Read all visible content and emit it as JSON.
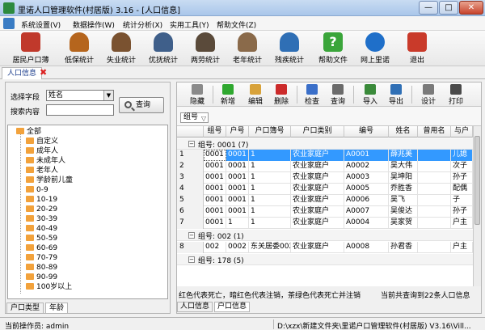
{
  "window": {
    "title": "里诺人口管理软件(村居版) 3.16 - [人口信息]",
    "min_label": "—",
    "max_label": "□",
    "close_label": "✕"
  },
  "menu": [
    "系统设置(V)",
    "数据操作(W)",
    "统计分析(X)",
    "实用工具(Y)",
    "帮助文件(Z)"
  ],
  "toolbar": [
    {
      "label": "居民户口薄",
      "icon": "resident-book-icon",
      "color": "#c0392b"
    },
    {
      "label": "低保统计",
      "icon": "person-icon",
      "color": "#b5651d"
    },
    {
      "label": "失业统计",
      "icon": "person-icon",
      "color": "#7a5230"
    },
    {
      "label": "优抚统计",
      "icon": "person-icon",
      "color": "#3f5f8a"
    },
    {
      "label": "两劳统计",
      "icon": "person-icon",
      "color": "#5a4a3a"
    },
    {
      "label": "老年统计",
      "icon": "person-icon",
      "color": "#8a6a4a"
    },
    {
      "label": "残疾统计",
      "icon": "person-icon",
      "color": "#2f6fb5"
    },
    {
      "label": "帮助文件",
      "icon": "help-icon",
      "color": "#3aa53a"
    },
    {
      "label": "网上里诺",
      "icon": "globe-icon",
      "color": "#1f6fc9"
    },
    {
      "label": "退出",
      "icon": "exit-icon",
      "color": "#c93a2a"
    }
  ],
  "doc_tab": {
    "label": "人口信息",
    "close": "✖"
  },
  "left": {
    "field_label": "选择字段",
    "field_value": "姓名",
    "search_label": "搜索内容",
    "query_label": "查询",
    "tree": [
      "全部",
      "自定义",
      "成年人",
      "未成年人",
      "老年人",
      "学龄前儿童",
      "0-9",
      "10-19",
      "20-29",
      "30-39",
      "40-49",
      "50-59",
      "60-69",
      "70-79",
      "80-89",
      "90-99",
      "100岁以上"
    ],
    "tabs": [
      "户口类型",
      "年龄"
    ]
  },
  "right_toolbar": [
    {
      "label": "隐藏",
      "icon": "hide-icon",
      "color": "#8a8a8a"
    },
    {
      "label": "新增",
      "icon": "add-icon",
      "color": "#2fa82f"
    },
    {
      "label": "编辑",
      "icon": "edit-icon",
      "color": "#d8a23a"
    },
    {
      "label": "删除",
      "icon": "delete-icon",
      "color": "#cc2b2b"
    },
    {
      "label": "检查",
      "icon": "check-icon",
      "color": "#3a6fc9"
    },
    {
      "label": "查询",
      "icon": "query-icon",
      "color": "#6b6b6b"
    },
    {
      "label": "导入",
      "icon": "import-icon",
      "color": "#3a8a3a"
    },
    {
      "label": "导出",
      "icon": "export-icon",
      "color": "#2f6fb5"
    },
    {
      "label": "设计",
      "icon": "design-icon",
      "color": "#7a7a7a"
    },
    {
      "label": "打印",
      "icon": "print-icon",
      "color": "#4a4a4a"
    }
  ],
  "group_by": {
    "label": "组号",
    "filter": "▽"
  },
  "grid": {
    "columns": [
      "组号",
      "户号",
      "户口簿号",
      "户口类别",
      "编号",
      "姓名",
      "曾用名",
      "与户"
    ],
    "groups": [
      {
        "label": "组号: 0001 (7)",
        "rows": [
          {
            "n": "1",
            "cells": [
              "0001",
              "0001",
              "1",
              "农业家庭户",
              "A0001",
              "薛兆美",
              "",
              "儿媳"
            ]
          },
          {
            "n": "2",
            "cells": [
              "0001",
              "0001",
              "1",
              "农业家庭户",
              "A0002",
              "吴大伟",
              "",
              "次子"
            ]
          },
          {
            "n": "3",
            "cells": [
              "0001",
              "0001",
              "1",
              "农业家庭户",
              "A0003",
              "吴坤阳",
              "",
              "孙子"
            ]
          },
          {
            "n": "4",
            "cells": [
              "0001",
              "0001",
              "1",
              "农业家庭户",
              "A0005",
              "乔胜香",
              "",
              "配偶"
            ]
          },
          {
            "n": "5",
            "cells": [
              "0001",
              "0001",
              "1",
              "农业家庭户",
              "A0006",
              "吴飞",
              "",
              "子"
            ]
          },
          {
            "n": "6",
            "cells": [
              "0001",
              "0001",
              "1",
              "农业家庭户",
              "A0007",
              "吴俊达",
              "",
              "孙子"
            ]
          },
          {
            "n": "7",
            "cells": [
              "0001",
              "1",
              "1",
              "农业家庭户",
              "A0004",
              "吴家贺",
              "",
              "户主"
            ]
          }
        ]
      },
      {
        "label": "组号: 002 (1)",
        "rows": [
          {
            "n": "8",
            "cells": [
              "002",
              "0002",
              "东关居委002",
              "农业家庭户",
              "A0008",
              "孙君香",
              "",
              "户主"
            ]
          }
        ]
      },
      {
        "label": "组号: 178 (5)",
        "rows": []
      }
    ]
  },
  "status_line": {
    "legend": "红色代表死亡，暗红色代表注销，茶绿色代表死亡并注销",
    "count": "当前共查询到22条人口信息"
  },
  "right_tabs": [
    "人口信息",
    "户口信息"
  ],
  "statusbar": {
    "operator": "当前操作员: admin",
    "path": "D:\\xzx\\新建文件夹\\里诺户口管理软件(村居版) V3.16\\Vill..."
  }
}
